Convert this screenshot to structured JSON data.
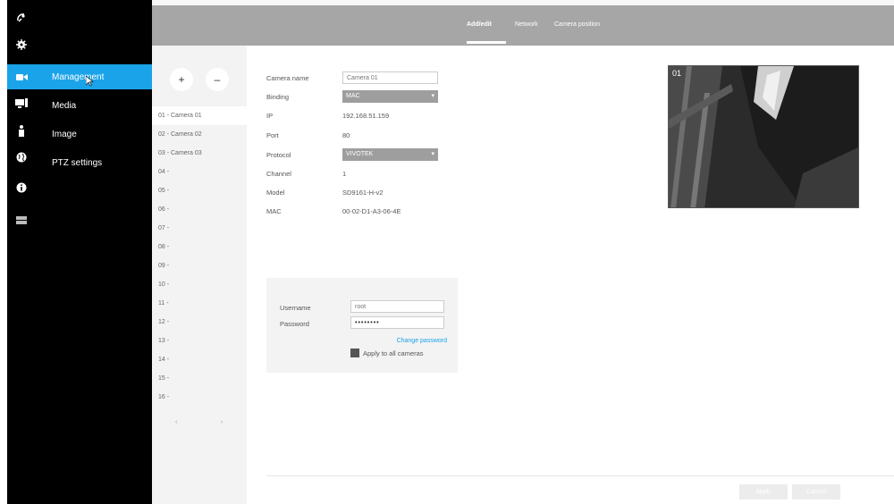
{
  "rail": {
    "icons": [
      "satellite-dish-icon",
      "gear-icon",
      "video-camera-icon",
      "monitor-icon",
      "person-icon",
      "globe-icon",
      "info-icon",
      "server-icon"
    ],
    "active_index": 2
  },
  "nav": {
    "items": [
      {
        "label": "Management",
        "active": true
      },
      {
        "label": "Media",
        "active": false
      },
      {
        "label": "Image",
        "active": false
      },
      {
        "label": "PTZ settings",
        "active": false
      }
    ]
  },
  "tabs": [
    {
      "label": "Add/edit",
      "active": true
    },
    {
      "label": "Network",
      "active": false
    },
    {
      "label": "Camera position",
      "active": false
    }
  ],
  "camera_list": {
    "add_symbol": "+",
    "remove_symbol": "–",
    "items": [
      "01 - Camera 01",
      "02 - Camera 02",
      "03 - Camera 03",
      "04 -",
      "05 -",
      "06 -",
      "07 -",
      "08 -",
      "09 -",
      "10 -",
      "11 -",
      "12 -",
      "13 -",
      "14 -",
      "15 -",
      "16 -"
    ],
    "selected_index": 0,
    "scroll_left": "‹",
    "scroll_right": "›"
  },
  "form": {
    "camera_name": {
      "label": "Camera name",
      "value": "Camera 01"
    },
    "binding": {
      "label": "Binding",
      "value": "MAC"
    },
    "ip": {
      "label": "IP",
      "value": "192.168.51.159"
    },
    "port": {
      "label": "Port",
      "value": "80"
    },
    "protocol": {
      "label": "Protocol",
      "value": "VIVOTEK"
    },
    "channel": {
      "label": "Channel",
      "value": "1"
    },
    "model": {
      "label": "Model",
      "value": "SD9161-H-v2"
    },
    "mac": {
      "label": "MAC",
      "value": "00-02-D1-A3-06-4E"
    }
  },
  "auth": {
    "username_label": "Username",
    "username_value": "root",
    "password_label": "Password",
    "password_value": "••••••••",
    "change_password": "Change password",
    "apply_all": "Apply to all cameras"
  },
  "preview": {
    "caption": "01"
  },
  "actions": {
    "apply": "Apply",
    "cancel": "Cancel"
  },
  "colors": {
    "accent": "#1aa3e8",
    "sidebar": "#000000",
    "topbar": "#a6a6a6"
  }
}
